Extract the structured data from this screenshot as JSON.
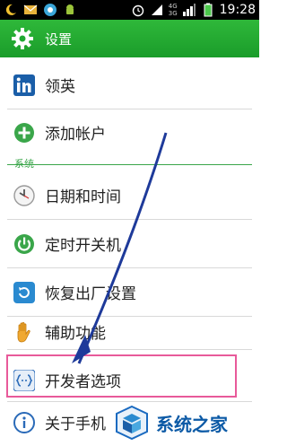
{
  "status_bar": {
    "time": "19:28",
    "net_top": "4G",
    "net_bottom": "3G"
  },
  "header": {
    "title": "设置",
    "icon": "gear-icon"
  },
  "items": [
    {
      "label": "领英",
      "icon": "linkedin-icon"
    },
    {
      "label": "添加帐户",
      "icon": "add-circle-icon"
    },
    {
      "label": "日期和时间",
      "icon": "clock-icon"
    },
    {
      "label": "定时开关机",
      "icon": "power-icon"
    },
    {
      "label": "恢复出厂设置",
      "icon": "restore-icon"
    },
    {
      "label": "辅助功能",
      "icon": "hand-icon"
    },
    {
      "label": "开发者选项",
      "icon": "developer-icon"
    },
    {
      "label": "关于手机",
      "icon": "info-icon"
    }
  ],
  "section": {
    "label": "系统"
  },
  "watermark": {
    "text": "系统之家"
  },
  "colors": {
    "header_green": "#1fa830",
    "section_green": "#3aa64a",
    "highlight_pink": "#e85a9a",
    "arrow_blue": "#1e3a9a"
  }
}
